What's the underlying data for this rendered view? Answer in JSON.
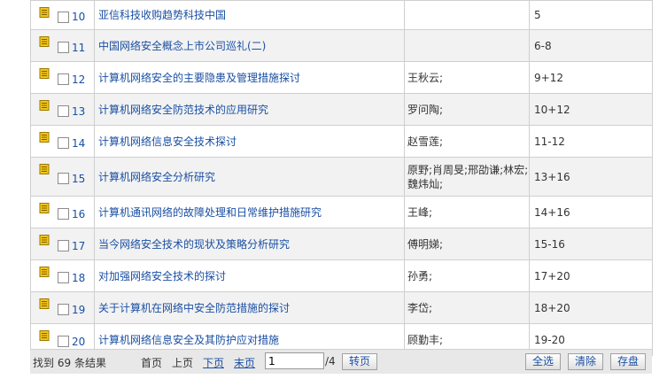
{
  "rows": [
    {
      "num": "10",
      "title": "亚信科技收购趋势科技中国",
      "author": "",
      "page": "5"
    },
    {
      "num": "11",
      "title": "中国网络安全概念上市公司巡礼(二)",
      "author": "",
      "page": "6-8"
    },
    {
      "num": "12",
      "title": "计算机网络安全的主要隐患及管理措施探讨",
      "author": "王秋云;",
      "page": "9+12"
    },
    {
      "num": "13",
      "title": "计算机网络安全防范技术的应用研究",
      "author": "罗问陶;",
      "page": "10+12"
    },
    {
      "num": "14",
      "title": "计算机网络信息安全技术探讨",
      "author": "赵雪莲;",
      "page": "11-12"
    },
    {
      "num": "15",
      "title": "计算机网络安全分析研究",
      "author": "原野;肖周旻;邢劭谦;林宏;魏炜灿;",
      "page": "13+16"
    },
    {
      "num": "16",
      "title": "计算机通讯网络的故障处理和日常维护措施研究",
      "author": "王峰;",
      "page": "14+16"
    },
    {
      "num": "17",
      "title": "当今网络安全技术的现状及策略分析研究",
      "author": "傅明娣;",
      "page": "15-16"
    },
    {
      "num": "18",
      "title": "对加强网络安全技术的探讨",
      "author": "孙勇;",
      "page": "17+20"
    },
    {
      "num": "19",
      "title": "关于计算机在网络中安全防范措施的探讨",
      "author": "李岱;",
      "page": "18+20"
    },
    {
      "num": "20",
      "title": "计算机网络信息安全及其防护应对措施",
      "author": "顾勤丰;",
      "page": "19-20"
    }
  ],
  "footer": {
    "found_prefix": "找到",
    "found_count": "69",
    "found_suffix": "条结果",
    "first_page": "首页",
    "prev_page": "上页",
    "next_page": "下页",
    "last_page": "末页",
    "page_value": "1",
    "total_pages": "/4",
    "goto_label": "转页",
    "select_all_label": "全选",
    "clear_label": "清除",
    "save_label": "存盘"
  },
  "colors": {
    "link": "#1a4fa3",
    "icon": "#e8b400",
    "row_alt": "#f2f2f2",
    "footer_bg": "#e8e8e8"
  },
  "icons": {
    "row_icon": "document-icon"
  }
}
